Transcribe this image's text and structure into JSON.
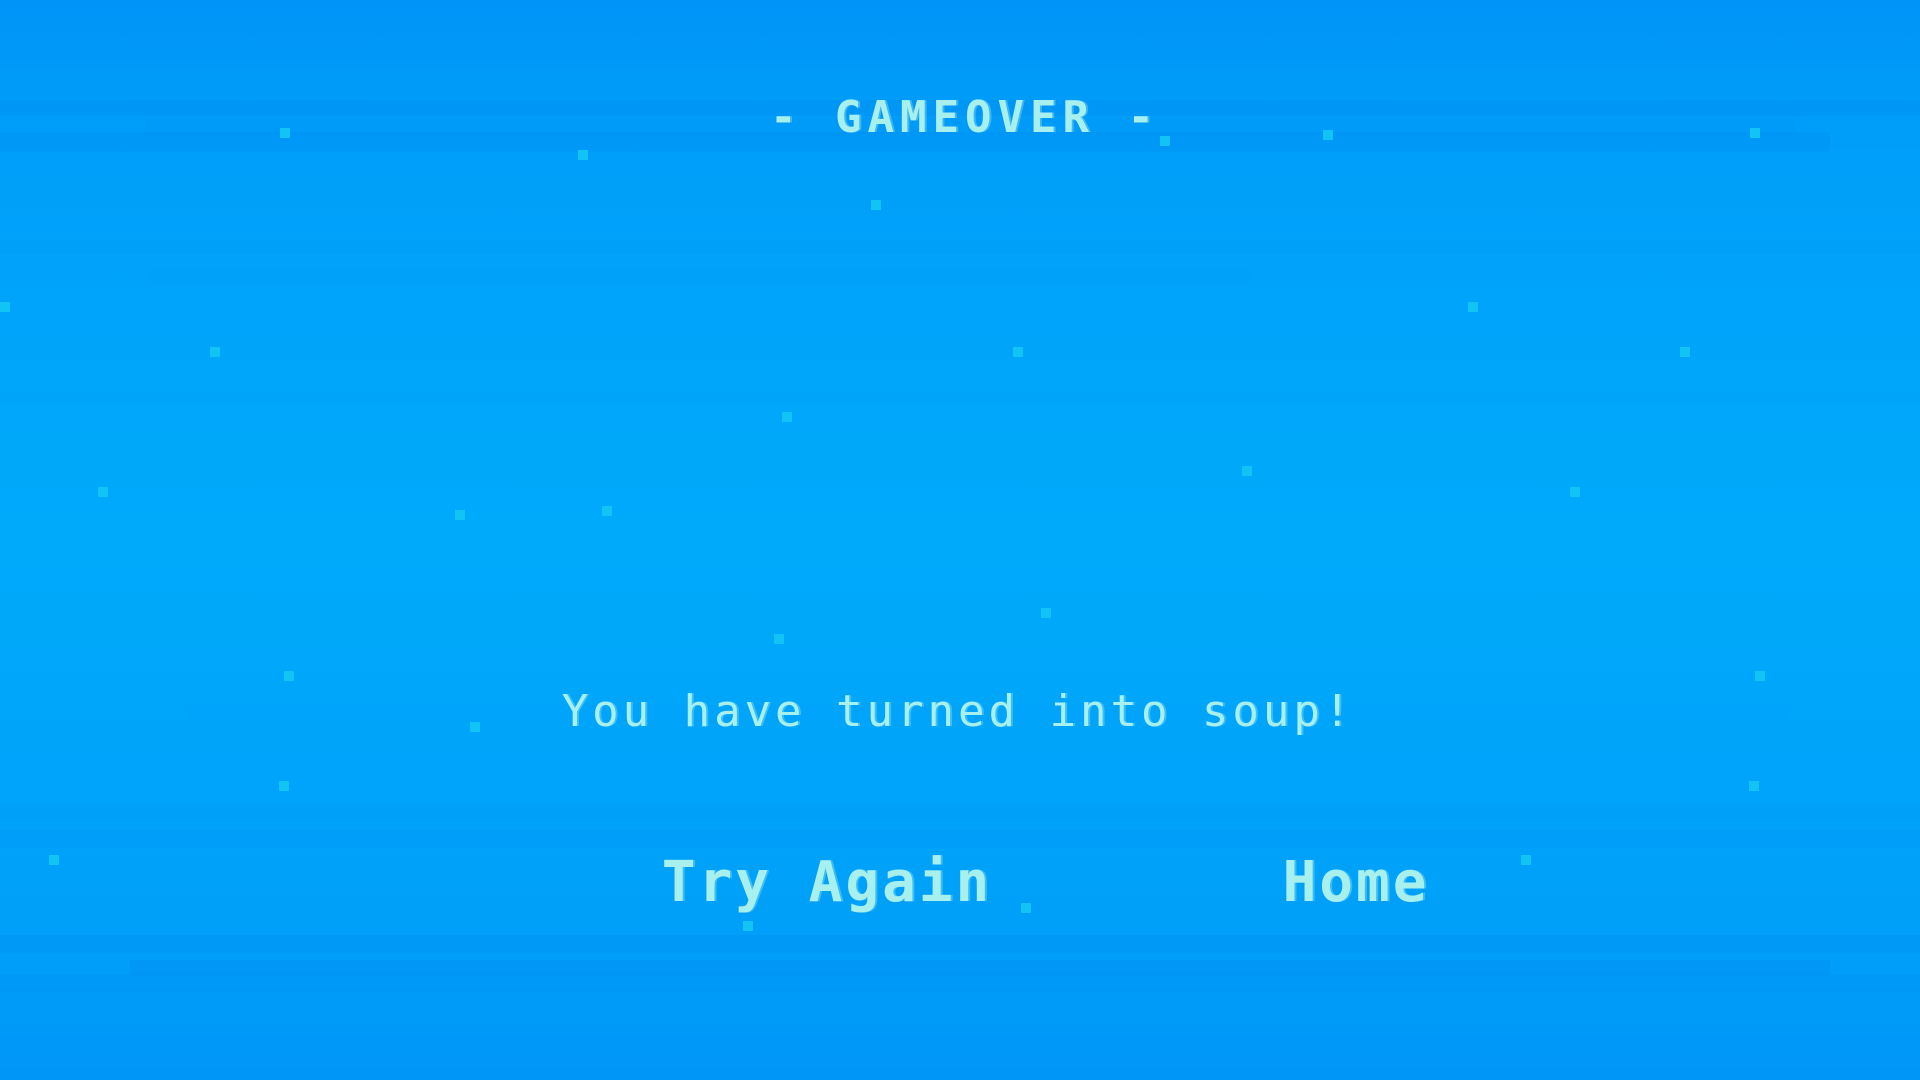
{
  "screen": {
    "title": "- GAMEOVER -",
    "message": "You have turned into soup!"
  },
  "menu": {
    "try_again_label": "Try Again",
    "home_label": "Home"
  },
  "colors": {
    "text": "#a8f0ee",
    "speck": "#12c3f6",
    "background_top": "#0094f8",
    "background_mid": "#00aafb"
  }
}
